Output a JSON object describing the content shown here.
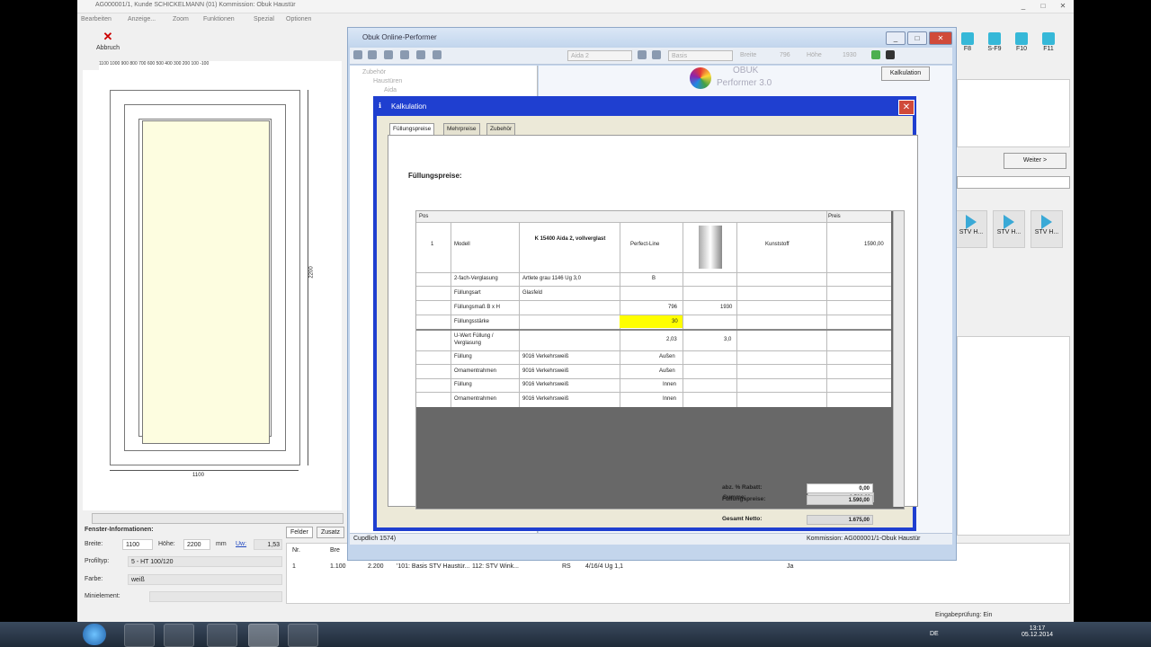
{
  "main_window": {
    "title": "AG000001/1, Kunde SCHICKELMANN (01) Kommission: Obuk Haustür",
    "menu": [
      "Bearbeiten",
      "Anzeige...",
      "Zoom",
      "Funktionen",
      "Spezial",
      "Optionen"
    ],
    "abbruch_label": "Abbruch",
    "ruler_top": "1100 1000 900 800 700 600 500 400 300 200 100 -100",
    "dim_width": "1100",
    "dim_height": "2200"
  },
  "fenster_info": {
    "heading": "Fenster-Informationen:",
    "breite_label": "Breite:",
    "breite_value": "1100",
    "hoehe_label": "Höhe:",
    "hoehe_value": "2200",
    "unit": "mm",
    "uw_label": "Uw:",
    "uw_value": "1,53",
    "profiltyp_label": "Profiltyp:",
    "profiltyp_value": "5 - HT 100/120",
    "farbe_label": "Farbe:",
    "farbe_value": "weiß",
    "miniel_label": "Minielement:"
  },
  "bottom_tabs": [
    "Felder",
    "Zusatz"
  ],
  "bottom_table": {
    "headers": [
      "Nr.",
      "Bre"
    ],
    "row": [
      "1",
      "1.100",
      "2.200",
      "'101: Basis STV Haustür...",
      "112: STV Wink...",
      "RS",
      "4/16/4 Ug 1,1",
      "Ja"
    ]
  },
  "right_panel": {
    "fkeys": [
      "F8",
      "S-F9",
      "F10",
      "F11"
    ],
    "weiter_label": "Weiter >",
    "stv_labels": [
      "STV H...",
      "STV H...",
      "STV H..."
    ],
    "eingabe": "Eingabeprüfung: Ein"
  },
  "performer": {
    "title": "Obuk Online-Performer",
    "aida_field": "Aida 2",
    "basis_field": "Basis",
    "breite_label": "Breite",
    "breite_value": "796",
    "hoehe_label": "Höhe",
    "hoehe_value": "1930",
    "logo_line1": "OBUK",
    "logo_line2": "Performer 3.0",
    "kalkulation_btn": "Kalkulation",
    "tree": [
      "Zubehör",
      "Haustüren",
      "Aida"
    ],
    "status_left": "Cupdlich 1574)",
    "status_right": "Kommission: AG000001/1-Obuk Haustür"
  },
  "kalkulation": {
    "title": "Kalkulation",
    "tabs": [
      "Füllungspreise",
      "Mehrpreise",
      "Zubehör"
    ],
    "heading": "Füllungspreise:",
    "header": {
      "pos": "Pos",
      "preis": "Preis"
    },
    "row1": {
      "pos": "1",
      "modell": "Modell",
      "name": "K 15400 Aida 2, vollverglast",
      "line": "Perfect-Line",
      "material": "Kunststoff",
      "preis": "1590,00"
    },
    "rows": [
      {
        "a": "2-fach-Verglasung",
        "b": "Artlete grau 1146 Ug 3,0",
        "c": "B",
        "d": ""
      },
      {
        "a": "Füllungsart",
        "b": "Glasfeld",
        "c": "",
        "d": ""
      },
      {
        "a": "Füllungsmaß B x H",
        "b": "",
        "c": "796",
        "d": "1930"
      },
      {
        "a": "Füllungsstärke",
        "b": "",
        "c": "30",
        "d": ""
      },
      {
        "a": "U-Wert Füllung /",
        "a2": "Verglasung",
        "b": "",
        "c": "2,03",
        "d": "3,0"
      },
      {
        "a": "Füllung",
        "b": "9016 Verkehrsweiß",
        "c": "Außen",
        "d": ""
      },
      {
        "a": "Ornamentrahmen",
        "b": "9016 Verkehrsweiß",
        "c": "Außen",
        "d": ""
      },
      {
        "a": "Füllung",
        "b": "9016 Verkehrsweiß",
        "c": "Innen",
        "d": ""
      },
      {
        "a": "Ornamentrahmen",
        "b": "9016 Verkehrsweiß",
        "c": "Innen",
        "d": ""
      }
    ],
    "summe_label": "Summe:",
    "summe_value": "1.590,00",
    "rabatt_label": "abz. % Rabatt:",
    "rabatt_value": "0,00",
    "fuellungspreise_label": "Füllungspreise:",
    "fuellungspreise_value": "1.590,00",
    "netto_label": "Gesamt Netto:",
    "netto_value": "1.675,00"
  },
  "taskbar": {
    "lang": "DE",
    "time": "13:17",
    "date": "05.12.2014"
  },
  "colors": {
    "dialog_blue": "#1f3fd0",
    "highlight_yellow": "#ffff00",
    "glass": "#fdfde0"
  }
}
